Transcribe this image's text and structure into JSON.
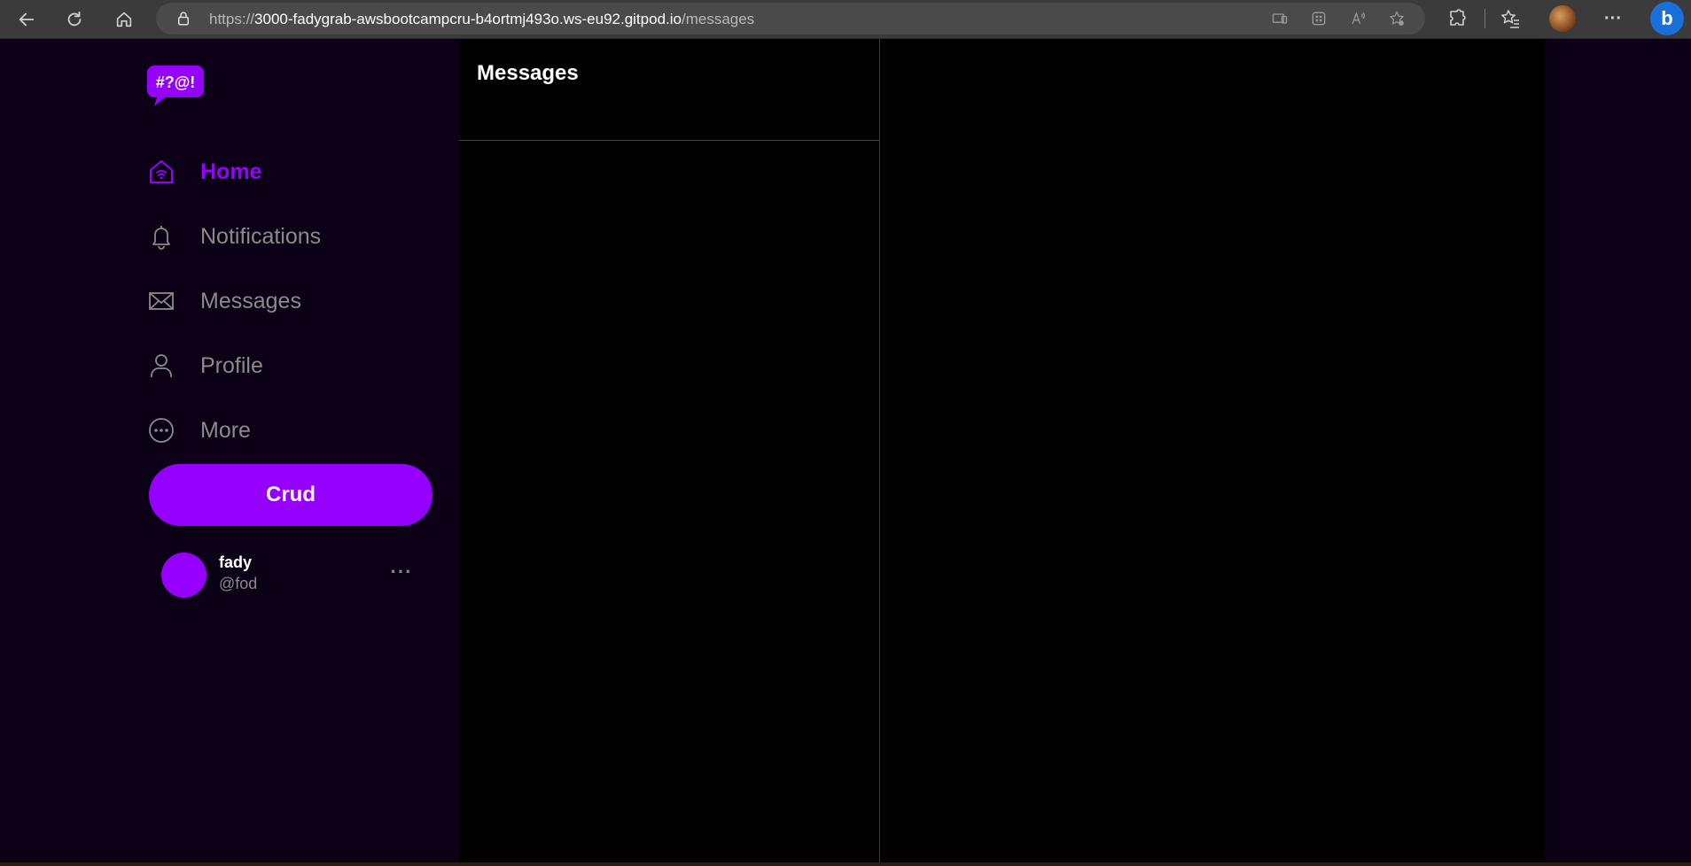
{
  "browser": {
    "url_scheme": "https://",
    "url_host": "3000-fadygrab-awsbootcampcru-b4ortmj493o.ws-eu92.gitpod.io",
    "url_path": "/messages"
  },
  "sidebar": {
    "logo_text": "#?@!",
    "items": [
      {
        "label": "Home",
        "icon": "home-icon",
        "active": true
      },
      {
        "label": "Notifications",
        "icon": "bell-icon",
        "active": false
      },
      {
        "label": "Messages",
        "icon": "envelope-icon",
        "active": false
      },
      {
        "label": "Profile",
        "icon": "person-icon",
        "active": false
      },
      {
        "label": "More",
        "icon": "ellipsis-circle-icon",
        "active": false
      }
    ],
    "crud_label": "Crud",
    "profile": {
      "display_name": "fady",
      "handle": "@fod",
      "more": "···"
    }
  },
  "messages": {
    "title": "Messages"
  },
  "colors": {
    "accent": "#9500ff",
    "sidebar_bg": "#0c0117",
    "panel_bg": "#000000",
    "muted": "#8a8a8a"
  }
}
